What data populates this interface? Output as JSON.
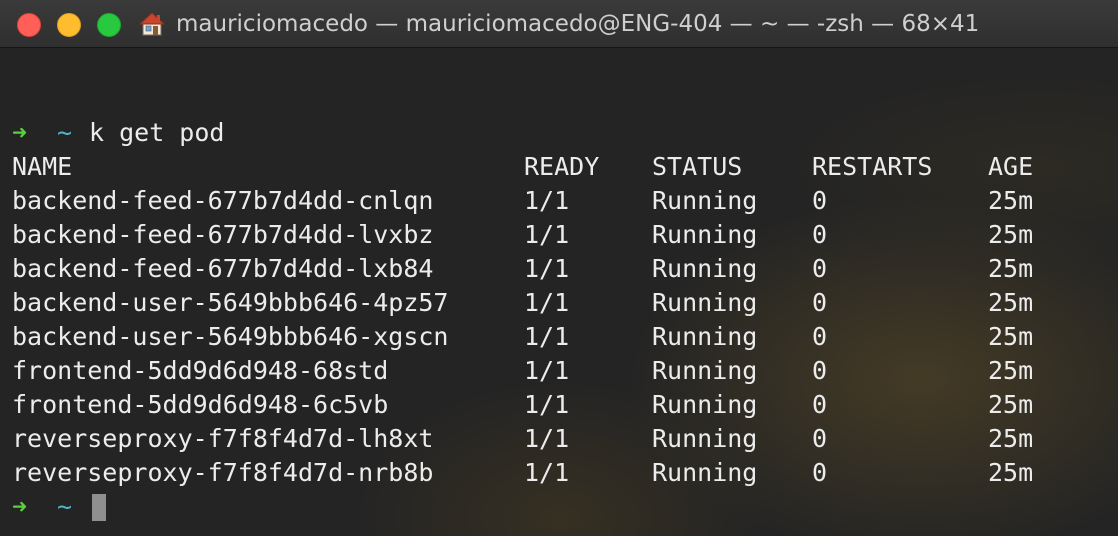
{
  "window": {
    "title": "mauriciomacedo — mauriciomacedo@ENG-404 — ~ — -zsh — 68×41"
  },
  "prompt": {
    "arrow": "➜",
    "dir": "~",
    "command": "k get pod"
  },
  "table": {
    "headers": [
      "NAME",
      "READY",
      "STATUS",
      "RESTARTS",
      "AGE"
    ],
    "rows": [
      [
        "backend-feed-677b7d4dd-cnlqn",
        "1/1",
        "Running",
        "0",
        "25m"
      ],
      [
        "backend-feed-677b7d4dd-lvxbz",
        "1/1",
        "Running",
        "0",
        "25m"
      ],
      [
        "backend-feed-677b7d4dd-lxb84",
        "1/1",
        "Running",
        "0",
        "25m"
      ],
      [
        "backend-user-5649bbb646-4pz57",
        "1/1",
        "Running",
        "0",
        "25m"
      ],
      [
        "backend-user-5649bbb646-xgscn",
        "1/1",
        "Running",
        "0",
        "25m"
      ],
      [
        "frontend-5dd9d6d948-68std",
        "1/1",
        "Running",
        "0",
        "25m"
      ],
      [
        "frontend-5dd9d6d948-6c5vb",
        "1/1",
        "Running",
        "0",
        "25m"
      ],
      [
        "reverseproxy-f7f8f4d7d-lh8xt",
        "1/1",
        "Running",
        "0",
        "25m"
      ],
      [
        "reverseproxy-f7f8f4d7d-nrb8b",
        "1/1",
        "Running",
        "0",
        "25m"
      ]
    ]
  },
  "icons": {
    "title_icon": "home-icon",
    "close": "close-icon",
    "minimize": "minimize-icon",
    "maximize": "maximize-icon"
  },
  "colors": {
    "prompt_arrow": "#5ad03c",
    "prompt_dir": "#4fb6c8",
    "text": "#ececec",
    "background": "#242424"
  }
}
